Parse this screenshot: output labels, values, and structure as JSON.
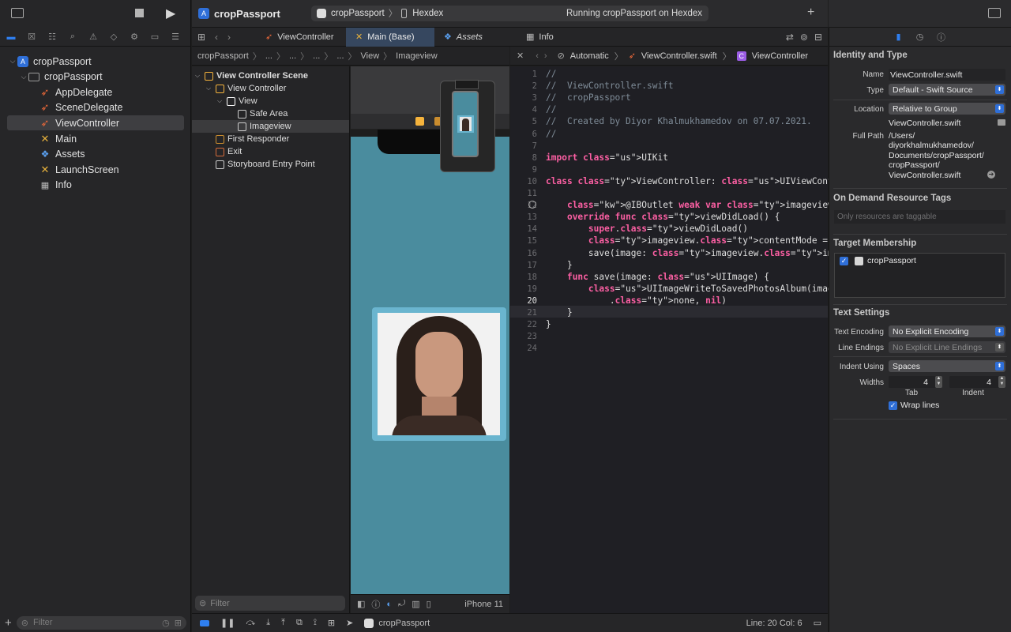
{
  "toolbar": {
    "app_title": "cropPassport",
    "scheme_name": "cropPassport",
    "destination": "Hexdex",
    "status": "Running cropPassport on Hexdex"
  },
  "navigator": {
    "items": [
      {
        "label": "cropPassport",
        "icon": "project-icon",
        "level": 0,
        "disclosure": "open"
      },
      {
        "label": "cropPassport",
        "icon": "folder-icon",
        "level": 1,
        "disclosure": "open"
      },
      {
        "label": "AppDelegate",
        "icon": "swift-file-icon",
        "level": 2
      },
      {
        "label": "SceneDelegate",
        "icon": "swift-file-icon",
        "level": 2
      },
      {
        "label": "ViewController",
        "icon": "swift-file-icon",
        "level": 2,
        "selected": true
      },
      {
        "label": "Main",
        "icon": "storyboard-icon",
        "level": 2
      },
      {
        "label": "Assets",
        "icon": "assets-icon",
        "level": 2
      },
      {
        "label": "LaunchScreen",
        "icon": "storyboard-icon",
        "level": 2
      },
      {
        "label": "Info",
        "icon": "plist-icon",
        "level": 2
      }
    ],
    "filter_placeholder": "Filter"
  },
  "tabs": [
    {
      "label": "ViewController",
      "icon": "swift-file-icon"
    },
    {
      "label": "Main (Base)",
      "icon": "storyboard-icon",
      "active": true
    },
    {
      "label": "Assets",
      "icon": "assets-icon"
    },
    {
      "label": "Info",
      "icon": "plist-icon"
    }
  ],
  "storyboard": {
    "jump_bar": [
      "cropPassport",
      "...",
      "...",
      "...",
      "...",
      "View",
      "Imageview"
    ],
    "outline": [
      {
        "label": "View Controller Scene",
        "level": 0,
        "bold": true
      },
      {
        "label": "View Controller",
        "level": 1
      },
      {
        "label": "View",
        "level": 2
      },
      {
        "label": "Safe Area",
        "level": 3
      },
      {
        "label": "Imageview",
        "level": 3,
        "selected": true
      },
      {
        "label": "First Responder",
        "level": 1
      },
      {
        "label": "Exit",
        "level": 1
      },
      {
        "label": "Storyboard Entry Point",
        "level": 1
      }
    ],
    "filter_placeholder": "Filter",
    "device": "iPhone 11"
  },
  "editor": {
    "jump_bar": {
      "mode": "Automatic",
      "file": "ViewController.swift",
      "symbol": "ViewController"
    },
    "current_line": 20,
    "lines": [
      "//",
      "//  ViewController.swift",
      "//  cropPassport",
      "//",
      "//  Created by Diyor Khalmukhamedov on 07.07.2021.",
      "//",
      "",
      "import UIKit",
      "",
      "class ViewController: UIViewController {",
      "",
      "    @IBOutlet weak var imageview: UIImageView!",
      "    override func viewDidLoad() {",
      "        super.viewDidLoad()",
      "        imageview.contentMode = .center",
      "        save(image: imageview.image!)",
      "    }",
      "    func save(image: UIImage) {",
      "        UIImageWriteToSavedPhotosAlbum(image, self,",
      "            .none, nil)",
      "    }",
      "}",
      "",
      ""
    ]
  },
  "status_bar": {
    "scheme": "cropPassport",
    "position": "Line: 20  Col: 6"
  },
  "inspector": {
    "identity": {
      "title": "Identity and Type",
      "name_label": "Name",
      "name": "ViewController.swift",
      "type_label": "Type",
      "type": "Default - Swift Source",
      "location_label": "Location",
      "location": "Relative to Group",
      "location_file": "ViewController.swift",
      "full_path_label": "Full Path",
      "full_path": [
        "/Users/",
        "diyorkhalmukhamedov/",
        "Documents/cropPassport/",
        "cropPassport/",
        "ViewController.swift"
      ]
    },
    "on_demand": {
      "title": "On Demand Resource Tags",
      "placeholder": "Only resources are taggable"
    },
    "target": {
      "title": "Target Membership",
      "item": "cropPassport",
      "checked": true
    },
    "text_settings": {
      "title": "Text Settings",
      "encoding_label": "Text Encoding",
      "encoding": "No Explicit Encoding",
      "endings_label": "Line Endings",
      "endings": "No Explicit Line Endings",
      "indent_label": "Indent Using",
      "indent": "Spaces",
      "widths_label": "Widths",
      "tab_width": "4",
      "tab_label": "Tab",
      "indent_width": "4",
      "indent_width_label": "Indent",
      "wrap_label": "Wrap lines",
      "wrap": true
    }
  },
  "colors": {
    "accent": "#2f7ff0",
    "canvas_bg": "#4a8c9e",
    "image_border": "#6ab5cf"
  }
}
